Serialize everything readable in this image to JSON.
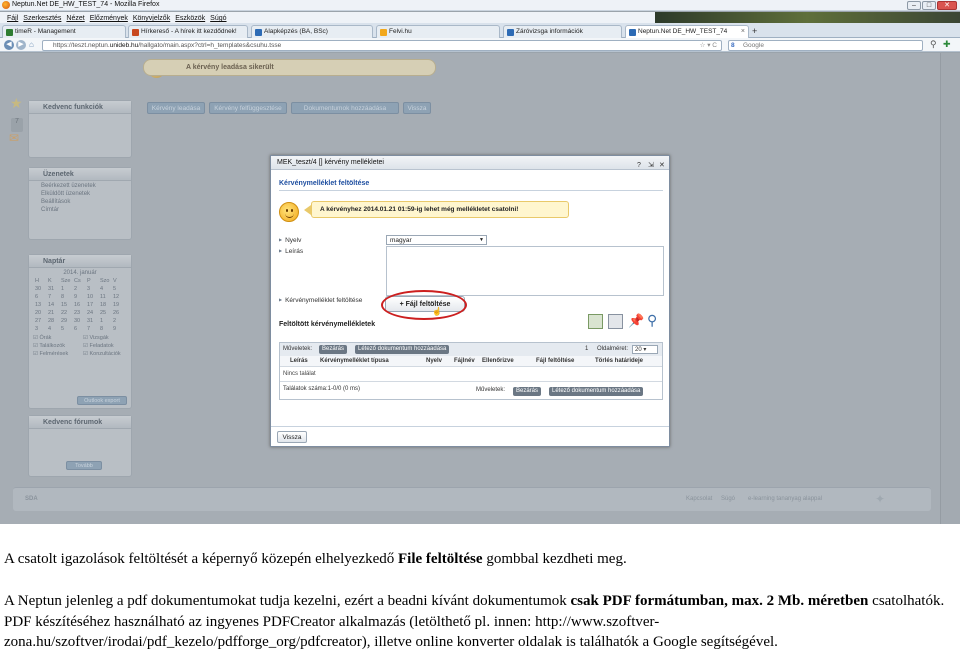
{
  "browser": {
    "window_title": "Neptun.Net DE_HW_TEST_74 - Mozilla Firefox",
    "menu": [
      "Fájl",
      "Szerkesztés",
      "Nézet",
      "Előzmények",
      "Könyvjelzők",
      "Eszközök",
      "Súgó"
    ],
    "tabs": [
      {
        "label": "timeR - Management",
        "active": false,
        "color": "#2f7d32"
      },
      {
        "label": "Hírkereső - A hírek itt kezdődnek!",
        "active": false,
        "color": "#c8481f"
      },
      {
        "label": "Alapképzés (BA, BSc)",
        "active": false,
        "color": "#2d6bb5"
      },
      {
        "label": "Felvi.hu",
        "active": false,
        "color": "#f2a81c"
      },
      {
        "label": "Záróvizsga információk",
        "active": false,
        "color": "#2d6bb5"
      },
      {
        "label": "Neptun.Net DE_HW_TEST_74",
        "active": true,
        "color": "#2d6bb5"
      }
    ],
    "new_tab": "+",
    "url_host": "https://teszt.neptun.",
    "url_domain": "unideb.hu",
    "url_path": "/hallgato/main.aspx?ctrl=h_templates&csuhu.tsse",
    "search_placeholder": "Google"
  },
  "page": {
    "success_message": "A kérvény leadása sikerült",
    "buttons": [
      "Kérvény leadása",
      "Kérvény felfüggesztése",
      "Dokumentumok hozzáadása",
      "Vissza"
    ],
    "panels": {
      "kedvenc_funkciok": "Kedvenc funkciók",
      "uzenetek": "Üzenetek",
      "uzenetek_items": [
        "Beérkezett üzenetek",
        "Elküldött üzenetek",
        "Beállítások",
        "Címtár"
      ],
      "naptar": "Naptár",
      "naptar_month": "2014. január",
      "naptar_days": [
        "H",
        "K",
        "Sze",
        "Cs",
        "P",
        "Szo",
        "V"
      ],
      "naptar_weeks": [
        [
          "30",
          "31",
          "1",
          "2",
          "3",
          "4",
          "5"
        ],
        [
          "6",
          "7",
          "8",
          "9",
          "10",
          "11",
          "12"
        ],
        [
          "13",
          "14",
          "15",
          "16",
          "17",
          "18",
          "19"
        ],
        [
          "20",
          "21",
          "22",
          "23",
          "24",
          "25",
          "26"
        ],
        [
          "27",
          "28",
          "29",
          "30",
          "31",
          "1",
          "2"
        ],
        [
          "3",
          "4",
          "5",
          "6",
          "7",
          "8",
          "9"
        ]
      ],
      "naptar_checks": [
        "Órák",
        "Vizsgák",
        "Találkozók",
        "Feladatok",
        "Felmérések",
        "Konzultációk"
      ],
      "naptar_button": "Outlook export",
      "kedvenc_forumok": "Kedvenc fórumok",
      "forum_button": "Tovább"
    },
    "footer_links": [
      "Kapcsolat",
      "Súgó",
      "e-learning tananyag alappal"
    ],
    "footer_left": "SDA"
  },
  "dialog": {
    "title": "MEK_teszt/4 [] kérvény mellékletei",
    "header_icons": [
      "?",
      "⇲",
      "✕"
    ],
    "subtitle": "Kérvénymelléklet feltöltése",
    "warning": "A kérvényhez 2014.01.21 01:59-ig lehet még mellékletet csatolni!",
    "nyelv_label": "Nyelv",
    "nyelv_value": "magyar",
    "leiras_label": "Leírás",
    "melleklet_label": "Kérvénymelléklet feltöltése",
    "upload_button": "+ Fájl feltöltése",
    "uploaded_title": "Feltöltött kérvénymellékletek",
    "muveletek": "Műveletek:",
    "bezaras": "Bezárás",
    "letezo": "Létező dokumentum hozzáadása",
    "page_label": "1",
    "page_size_label": "Oldalméret:",
    "page_size": "20",
    "columns": [
      "Leírás",
      "Kérvénymelléklet típusa",
      "Nyelv",
      "Fájlnév",
      "Ellenőrizve",
      "Fájl feltöltése",
      "Törlés határideje"
    ],
    "no_result": "Nincs találat",
    "result_count": "Találatok száma:1-0/0 (0 ms)",
    "back_button": "Vissza"
  },
  "caption": {
    "line1_pre": "A csatolt igazolások feltöltését a képernyő közepén elhelyezkedő ",
    "line1_bold": "File feltöltése",
    "line1_post": " gombbal kezdheti meg.",
    "p2_pre": "A Neptun jelenleg a pdf dokumentumokat tudja kezelni, ezért a beadni kívánt dokumentumok ",
    "p2_bold": "csak PDF formátumban, max. 2 Mb. méretben",
    "p2_post": " csatolhatók. PDF készítéséhez használható az ingyenes PDFCreator alkalmazás (letölthető pl. innen: http://www.szoftver-zona.hu/szoftver/irodai/pdf_kezelo/pdfforge_org/pdfcreator), illetve online konverter oldalak is találhatók a Google segítségével."
  }
}
